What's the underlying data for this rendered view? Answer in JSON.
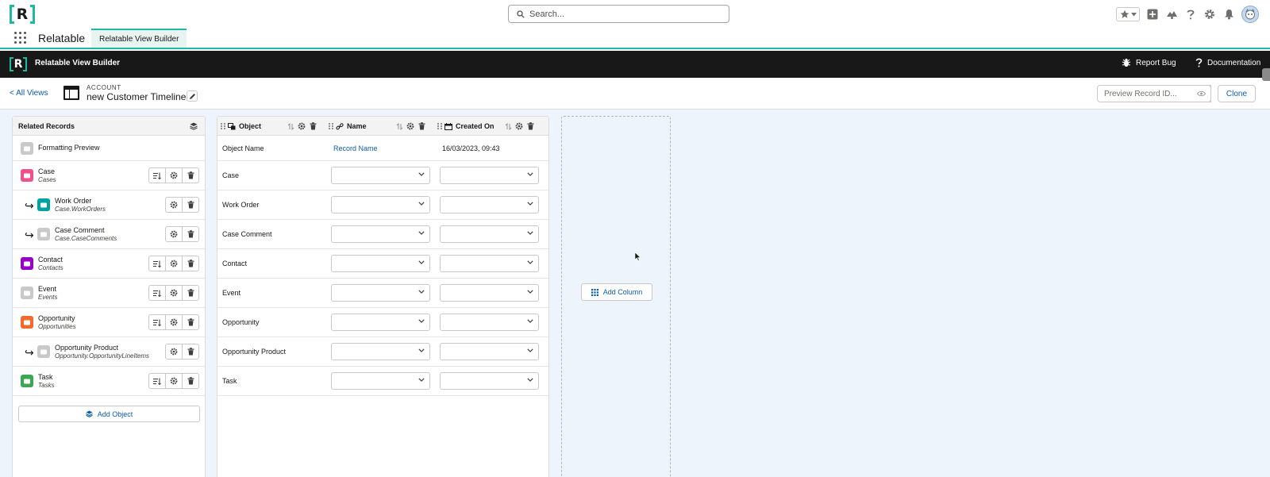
{
  "global_header": {
    "logo_letter": "R",
    "search_placeholder": "Search..."
  },
  "app_nav": {
    "app_name": "Relatable",
    "tab_label": "Relatable View Builder"
  },
  "builder_bar": {
    "logo_letter": "R",
    "title": "Relatable View Builder",
    "report_bug": "Report Bug",
    "documentation": "Documentation"
  },
  "view_header": {
    "all_views": "< All Views",
    "object_label": "ACCOUNT",
    "view_name": "new Customer Timeline",
    "preview_placeholder": "Preview Record ID...",
    "clone": "Clone"
  },
  "related_records": {
    "title": "Related Records",
    "items": [
      {
        "name": "Formatting Preview",
        "api": "",
        "color": "#c9c9c9",
        "icon": "formatting-icon",
        "child": false,
        "has_sort": false,
        "has_actions": false
      },
      {
        "name": "Case",
        "api": "Cases",
        "color": "#f2508a",
        "icon": "case-icon",
        "child": false,
        "has_sort": true,
        "has_actions": true
      },
      {
        "name": "Work Order",
        "api": "Case.WorkOrders",
        "color": "#00a1a1",
        "icon": "work-order-icon",
        "child": true,
        "has_sort": false,
        "has_actions": true
      },
      {
        "name": "Case Comment",
        "api": "Case.CaseComments",
        "color": "#c9c9c9",
        "icon": "comment-icon",
        "child": true,
        "has_sort": false,
        "has_actions": true
      },
      {
        "name": "Contact",
        "api": "Contacts",
        "color": "#9602c7",
        "icon": "contact-icon",
        "child": false,
        "has_sort": true,
        "has_actions": true
      },
      {
        "name": "Event",
        "api": "Events",
        "color": "#c9c9c9",
        "icon": "event-icon",
        "child": false,
        "has_sort": true,
        "has_actions": true
      },
      {
        "name": "Opportunity",
        "api": "Opportunities",
        "color": "#f26a2c",
        "icon": "opportunity-icon",
        "child": false,
        "has_sort": true,
        "has_actions": true
      },
      {
        "name": "Opportunity Product",
        "api": "Opportunity.OpportunityLineItems",
        "color": "#c9c9c9",
        "icon": "product-icon",
        "child": true,
        "has_sort": false,
        "has_actions": true
      },
      {
        "name": "Task",
        "api": "Tasks",
        "color": "#3ba755",
        "icon": "task-icon",
        "child": false,
        "has_sort": true,
        "has_actions": true
      }
    ],
    "add_object": "Add Object"
  },
  "grid": {
    "columns": [
      {
        "label": "Object",
        "icon": "object-icon"
      },
      {
        "label": "Name",
        "icon": "link-icon"
      },
      {
        "label": "Created On",
        "icon": "calendar-icon"
      }
    ],
    "preview_row": {
      "object": "Object Name",
      "name": "Record Name",
      "created": "16/03/2023, 09:43"
    },
    "rows": [
      "Case",
      "Work Order",
      "Case Comment",
      "Contact",
      "Event",
      "Opportunity",
      "Opportunity Product",
      "Task"
    ]
  },
  "add_column": "Add Column",
  "colors": {
    "brand_teal": "#1fb8a0",
    "link_blue": "#0b5cab",
    "dark_bar": "#181818",
    "canvas_bg": "#eef4fc"
  }
}
